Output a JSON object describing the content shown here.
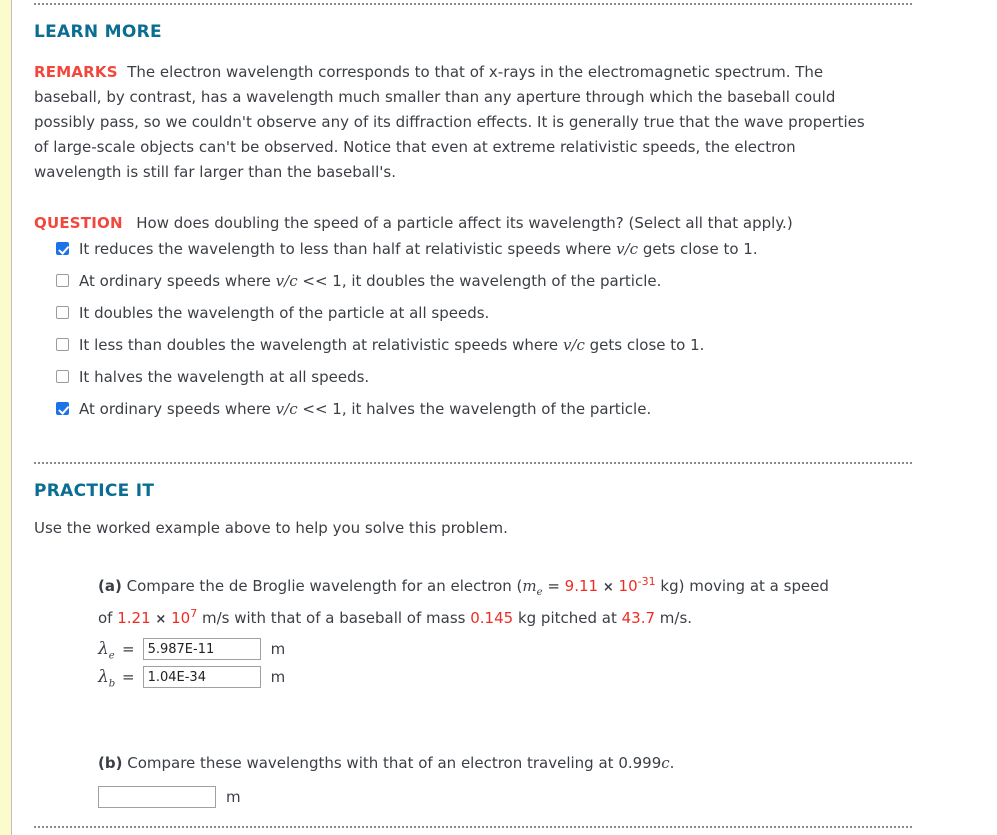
{
  "learn_more": {
    "title": "LEARN MORE",
    "remarks_label": "REMARKS",
    "remarks_text": "The electron wavelength corresponds to that of x-rays in the electromagnetic spectrum. The baseball, by contrast, has a wavelength much smaller than any aperture through which the baseball could possibly pass, so we couldn't observe any of its diffraction effects. It is generally true that the wave properties of large-scale objects can't be observed. Notice that even at extreme relativistic speeds, the electron wavelength is still far larger than the baseball's."
  },
  "question": {
    "label": "QUESTION",
    "prompt": "How does doubling the speed of a particle affect its wavelength? (Select all that apply.)",
    "options": [
      {
        "checked": true,
        "prefix": "It reduces the wavelength to less than half at relativistic speeds where ",
        "math": "v/c",
        "suffix": " gets close to 1."
      },
      {
        "checked": false,
        "prefix": "At ordinary speeds where ",
        "math": "v/c",
        "suffix": " << 1, it doubles the wavelength of the particle."
      },
      {
        "checked": false,
        "prefix": "It doubles the wavelength of the particle at all speeds.",
        "math": "",
        "suffix": ""
      },
      {
        "checked": false,
        "prefix": "It less than doubles the wavelength at relativistic speeds where ",
        "math": "v/c",
        "suffix": " gets close to 1."
      },
      {
        "checked": false,
        "prefix": "It halves the wavelength at all speeds.",
        "math": "",
        "suffix": ""
      },
      {
        "checked": true,
        "prefix": "At ordinary speeds where ",
        "math": "v/c",
        "suffix": " << 1, it halves the wavelength of the particle."
      }
    ]
  },
  "practice": {
    "title": "PRACTICE IT",
    "intro": "Use the worked example above to help you solve this problem.",
    "part_a": {
      "label": "(a)",
      "text_1": "Compare the de Broglie wavelength for an electron (",
      "mass_symbol": "m",
      "mass_symbol_sub": "e",
      "eq": " = ",
      "mass_value": "9.11",
      "mass_times": "×",
      "mass_base": "10",
      "mass_exp": "-31",
      "text_2": " kg) moving at a speed",
      "text_3": "of ",
      "speed_value": "1.21",
      "speed_times": "×",
      "speed_base": "10",
      "speed_exp": "7",
      "text_4": " m/s with that of a baseball of mass ",
      "ball_mass": "0.145",
      "text_5": " kg pitched at ",
      "ball_speed": "43.7",
      "text_6": " m/s.",
      "rows": [
        {
          "symbol": "λ",
          "sub": "e",
          "equals": "=",
          "value": "5.987E-11",
          "placeholder": "",
          "unit": "m"
        },
        {
          "symbol": "λ",
          "sub": "b",
          "equals": "=",
          "value": "1.04E-34",
          "placeholder": "",
          "unit": "m"
        }
      ]
    },
    "part_b": {
      "label": "(b)",
      "text_1": "Compare these wavelengths with that of an electron traveling at ",
      "speed": "0.999",
      "speed_unit": "c",
      "text_2": ".",
      "row": {
        "value": "",
        "placeholder": "",
        "unit": "m"
      }
    }
  },
  "colors": {
    "heading_teal": "#0a6d92",
    "label_red": "#f1473c",
    "value_red": "#ee2d24",
    "checkbox_blue": "#1a73e8",
    "gutter_yellow": "#fbfbcd",
    "body_text": "#3b3f45"
  }
}
